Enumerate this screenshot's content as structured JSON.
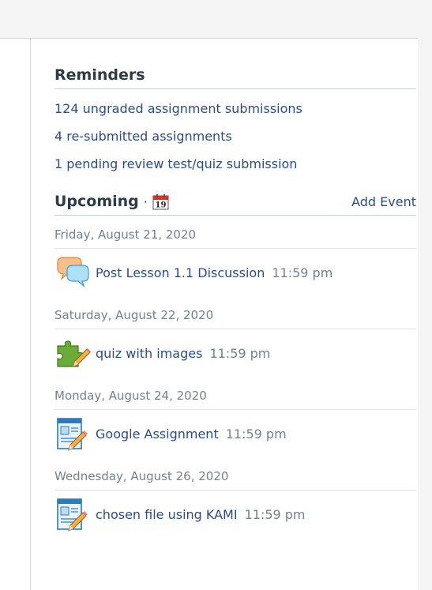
{
  "reminders": {
    "title": "Reminders",
    "links": [
      "124 ungraded assignment submissions",
      "4 re-submitted assignments",
      "1 pending review test/quiz submission"
    ]
  },
  "upcoming": {
    "title": "Upcoming",
    "separator": "·",
    "calendar_day": "19",
    "add_event_label": "Add Event",
    "days": [
      {
        "date": "Friday, August 21, 2020",
        "item": "Post Lesson 1.1 Discussion",
        "time": "11:59 pm",
        "icon": "discussion-icon"
      },
      {
        "date": "Saturday, August 22, 2020",
        "item": "quiz with images",
        "time": "11:59 pm",
        "icon": "quiz-icon"
      },
      {
        "date": "Monday, August 24, 2020",
        "item": "Google Assignment",
        "time": "11:59 pm",
        "icon": "assignment-icon"
      },
      {
        "date": "Wednesday, August 26, 2020",
        "item": "chosen file using KAMI",
        "time": "11:59 pm",
        "icon": "assignment-icon"
      }
    ]
  },
  "colors": {
    "link": "#2b4b8c",
    "heading": "#2d3b45",
    "muted": "#73818c",
    "calendar_red": "#d0342c"
  }
}
